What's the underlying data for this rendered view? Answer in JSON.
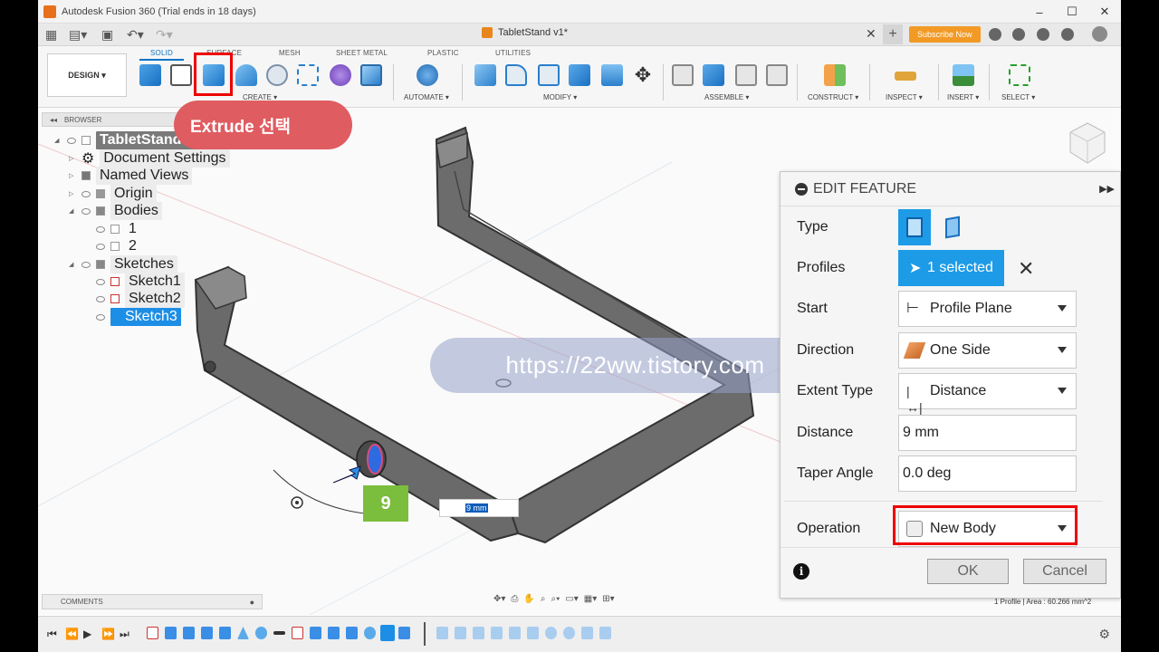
{
  "window": {
    "title": "Autodesk Fusion 360 (Trial ends in 18 days)"
  },
  "document_tab": {
    "name": "TabletStand v1*"
  },
  "subscribe_label": "Subscribe Now",
  "design_button": "DESIGN ▾",
  "ribbon": {
    "tabs": [
      "SOLID",
      "SURFACE",
      "MESH",
      "SHEET METAL",
      "PLASTIC",
      "UTILITIES"
    ],
    "active_tab": "SOLID",
    "groups": [
      "CREATE ▾",
      "AUTOMATE ▾",
      "MODIFY ▾",
      "ASSEMBLE ▾",
      "CONSTRUCT ▾",
      "INSPECT ▾",
      "INSERT ▾",
      "SELECT ▾"
    ]
  },
  "browser": {
    "header": "BROWSER",
    "items": [
      "TabletStand v1",
      "Document Settings",
      "Named Views",
      "Origin",
      "Bodies",
      "1",
      "2",
      "Sketches",
      "Sketch1",
      "Sketch2",
      "Sketch3"
    ]
  },
  "callout": "Extrude 선택",
  "watermark": "https://22ww.tistory.com",
  "step_badge": "9",
  "dim_value": "9 mm",
  "edit_feature": {
    "title": "EDIT FEATURE",
    "rows": {
      "type": "Type",
      "profiles": "Profiles",
      "profiles_value": "1 selected",
      "start": "Start",
      "start_value": "Profile Plane",
      "direction": "Direction",
      "direction_value": "One Side",
      "extent_type": "Extent Type",
      "extent_value": "Distance",
      "distance": "Distance",
      "distance_value": "9 mm",
      "taper": "Taper Angle",
      "taper_value": "0.0 deg",
      "operation": "Operation",
      "operation_value": "New Body"
    },
    "ok": "OK",
    "cancel": "Cancel"
  },
  "status_text": "1 Profile | Area : 60.266 mm^2",
  "comments_label": "COMMENTS",
  "colors": {
    "accent": "#1d9be6",
    "highlight_red": "#e00000",
    "callout": "#df5c61",
    "badge_green": "#7bbd3c"
  }
}
